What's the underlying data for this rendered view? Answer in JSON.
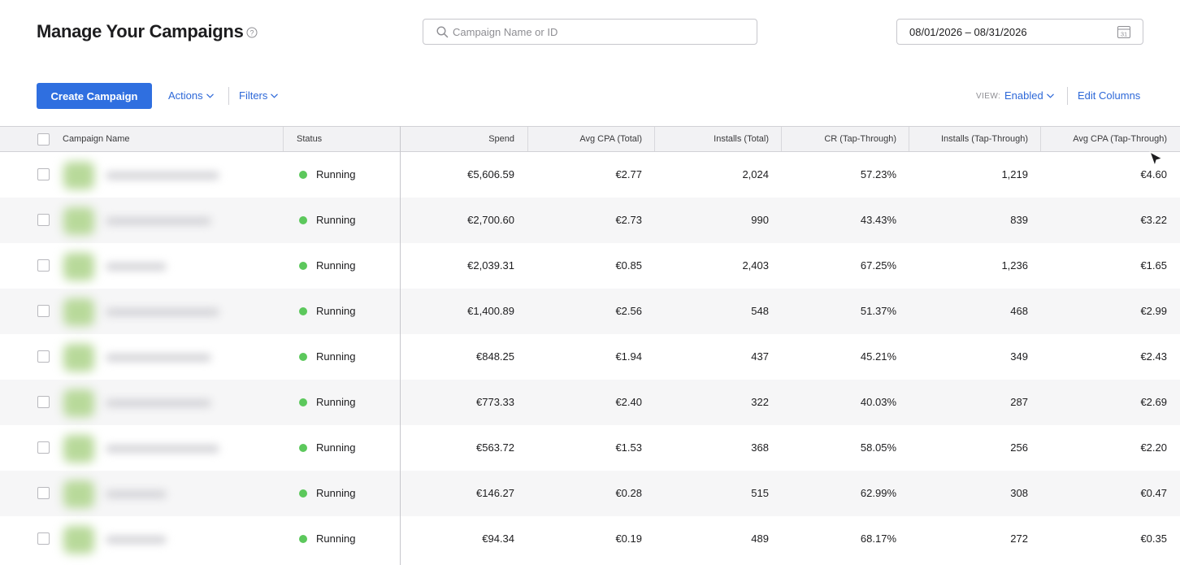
{
  "page": {
    "title": "Manage Your Campaigns",
    "help_icon": "question-circle-icon"
  },
  "search": {
    "placeholder": "Campaign Name or ID",
    "value": "",
    "icon": "search-icon"
  },
  "date_range": {
    "value": "08/01/2026 – 08/31/2026",
    "icon": "calendar-icon",
    "calendar_day": "31"
  },
  "toolbar": {
    "create_label": "Create Campaign",
    "actions_label": "Actions",
    "filters_label": "Filters",
    "view_prefix": "VIEW:",
    "view_value": "Enabled",
    "edit_columns_label": "Edit Columns"
  },
  "colors": {
    "accent": "#2d68d8",
    "primary_button": "#2f6fe0",
    "status_running": "#5cc85c"
  },
  "table": {
    "columns": [
      "Campaign Name",
      "Status",
      "Spend",
      "Avg CPA (Total)",
      "Installs (Total)",
      "CR (Tap-Through)",
      "Installs (Tap-Through)",
      "Avg CPA (Tap-Through)"
    ],
    "rows": [
      {
        "status": "Running",
        "spend": "€5,606.59",
        "avg_cpa_total": "€2.77",
        "installs_total": "2,024",
        "cr_tap": "57.23%",
        "installs_tap": "1,219",
        "avg_cpa_tap": "€4.60"
      },
      {
        "status": "Running",
        "spend": "€2,700.60",
        "avg_cpa_total": "€2.73",
        "installs_total": "990",
        "cr_tap": "43.43%",
        "installs_tap": "839",
        "avg_cpa_tap": "€3.22"
      },
      {
        "status": "Running",
        "spend": "€2,039.31",
        "avg_cpa_total": "€0.85",
        "installs_total": "2,403",
        "cr_tap": "67.25%",
        "installs_tap": "1,236",
        "avg_cpa_tap": "€1.65"
      },
      {
        "status": "Running",
        "spend": "€1,400.89",
        "avg_cpa_total": "€2.56",
        "installs_total": "548",
        "cr_tap": "51.37%",
        "installs_tap": "468",
        "avg_cpa_tap": "€2.99"
      },
      {
        "status": "Running",
        "spend": "€848.25",
        "avg_cpa_total": "€1.94",
        "installs_total": "437",
        "cr_tap": "45.21%",
        "installs_tap": "349",
        "avg_cpa_tap": "€2.43"
      },
      {
        "status": "Running",
        "spend": "€773.33",
        "avg_cpa_total": "€2.40",
        "installs_total": "322",
        "cr_tap": "40.03%",
        "installs_tap": "287",
        "avg_cpa_tap": "€2.69"
      },
      {
        "status": "Running",
        "spend": "€563.72",
        "avg_cpa_total": "€1.53",
        "installs_total": "368",
        "cr_tap": "58.05%",
        "installs_tap": "256",
        "avg_cpa_tap": "€2.20"
      },
      {
        "status": "Running",
        "spend": "€146.27",
        "avg_cpa_total": "€0.28",
        "installs_total": "515",
        "cr_tap": "62.99%",
        "installs_tap": "308",
        "avg_cpa_tap": "€0.47"
      },
      {
        "status": "Running",
        "spend": "€94.34",
        "avg_cpa_total": "€0.19",
        "installs_total": "489",
        "cr_tap": "68.17%",
        "installs_tap": "272",
        "avg_cpa_tap": "€0.35"
      }
    ]
  }
}
